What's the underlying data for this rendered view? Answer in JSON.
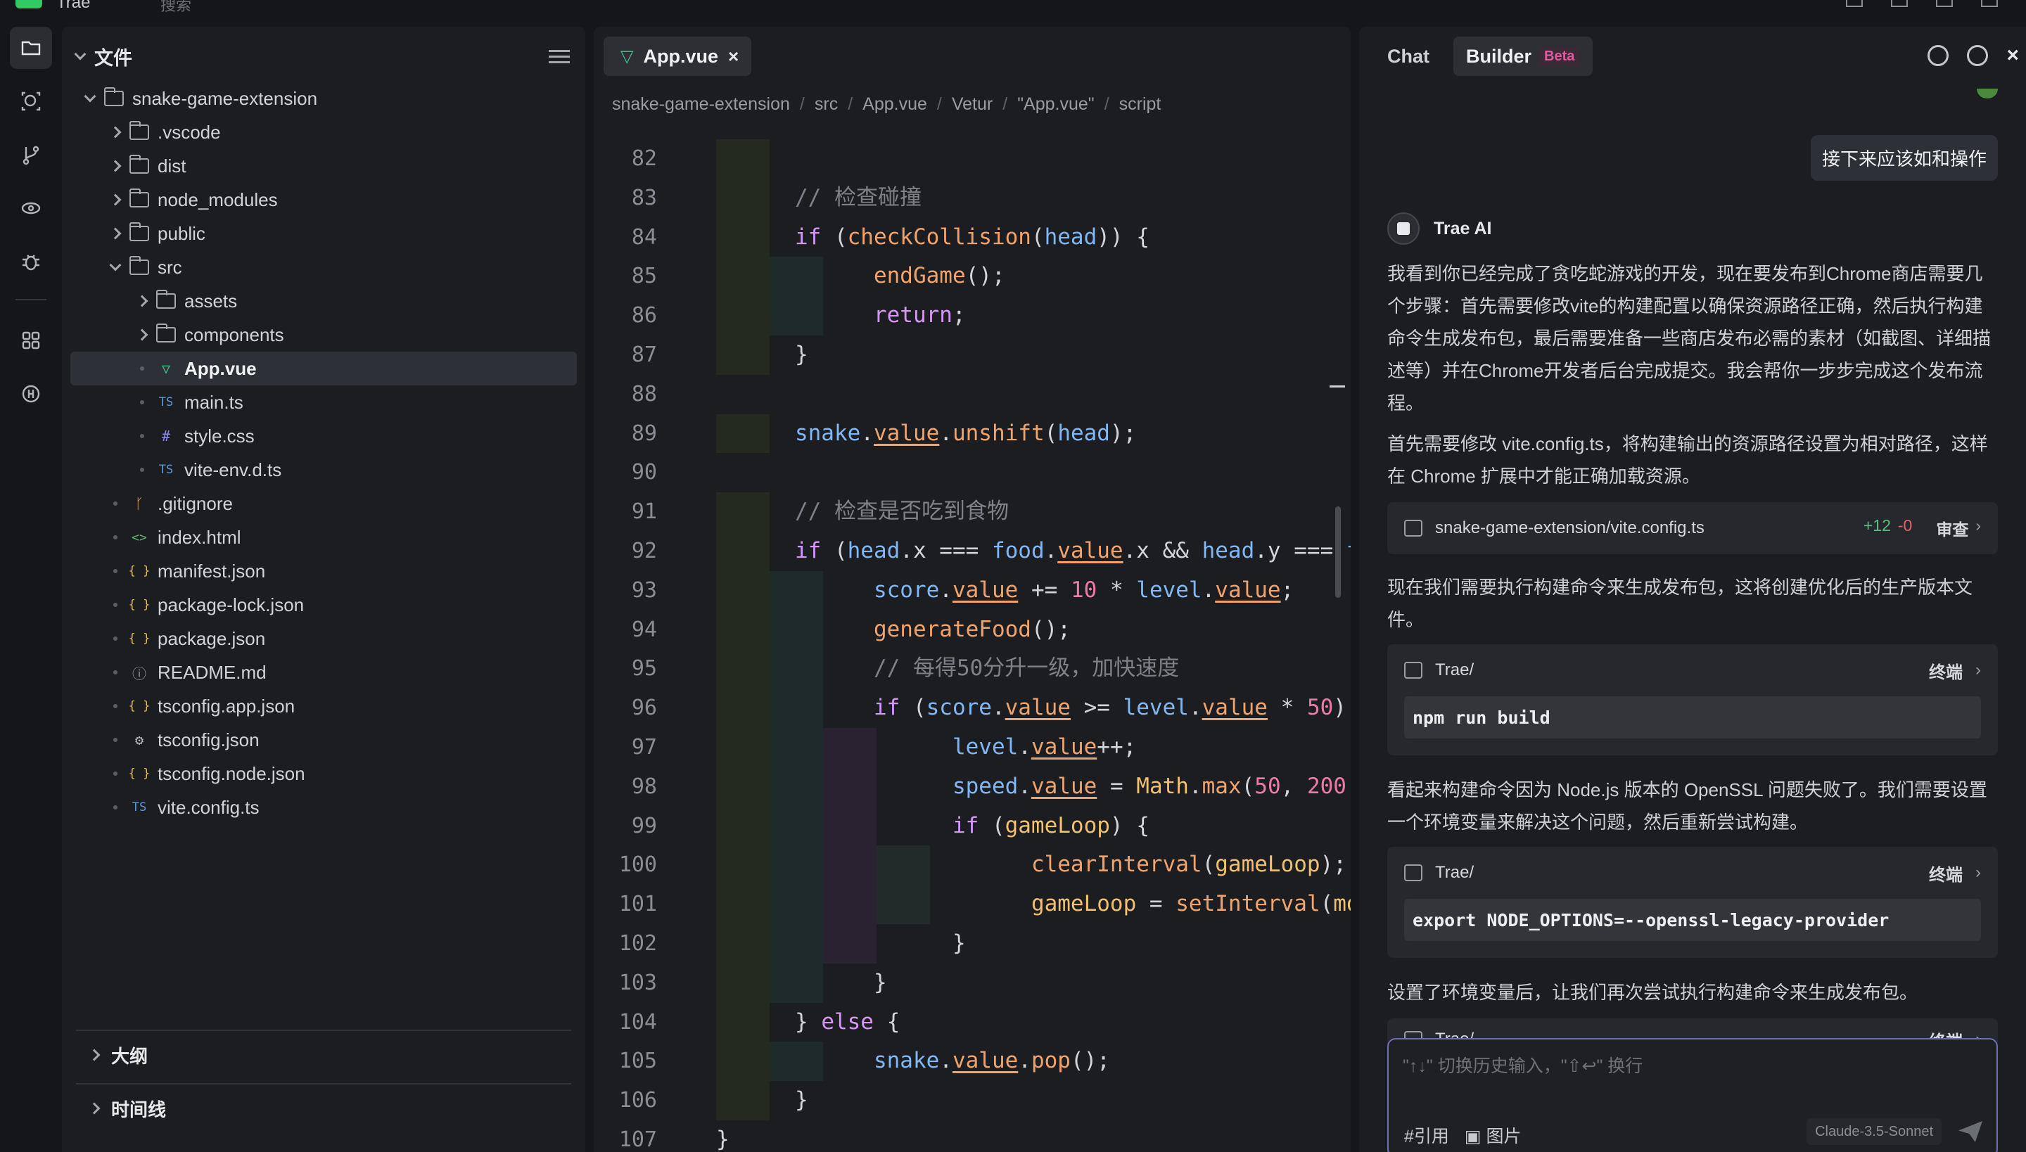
{
  "titlebar": {
    "app_name": "Trae",
    "search_placeholder": "搜索"
  },
  "activity": {
    "items": [
      {
        "icon": "folder-icon",
        "active": true
      },
      {
        "icon": "search-icon"
      },
      {
        "icon": "source-control-icon"
      },
      {
        "icon": "extensions-eye-icon"
      },
      {
        "icon": "debug-icon"
      },
      {
        "icon": "apps-grid-icon"
      },
      {
        "icon": "remote-icon"
      }
    ]
  },
  "explorer": {
    "title": "文件",
    "root": "snake-game-extension",
    "tree": [
      {
        "label": ".vscode",
        "type": "folder",
        "level": 1,
        "expanded": false
      },
      {
        "label": "dist",
        "type": "folder",
        "level": 1,
        "expanded": false
      },
      {
        "label": "node_modules",
        "type": "folder",
        "level": 1,
        "expanded": false
      },
      {
        "label": "public",
        "type": "folder",
        "level": 1,
        "expanded": false
      },
      {
        "label": "src",
        "type": "folder",
        "level": 1,
        "expanded": true
      },
      {
        "label": "assets",
        "type": "folder",
        "level": 2,
        "expanded": false
      },
      {
        "label": "components",
        "type": "folder",
        "level": 2,
        "expanded": false
      },
      {
        "label": "App.vue",
        "type": "vue",
        "level": 2,
        "selected": true
      },
      {
        "label": "main.ts",
        "type": "ts",
        "level": 2
      },
      {
        "label": "style.css",
        "type": "css",
        "level": 2
      },
      {
        "label": "vite-env.d.ts",
        "type": "ts",
        "level": 2
      },
      {
        "label": ".gitignore",
        "type": "git",
        "level": 1
      },
      {
        "label": "index.html",
        "type": "html",
        "level": 1
      },
      {
        "label": "manifest.json",
        "type": "json",
        "level": 1
      },
      {
        "label": "package-lock.json",
        "type": "json",
        "level": 1
      },
      {
        "label": "package.json",
        "type": "json",
        "level": 1
      },
      {
        "label": "README.md",
        "type": "info",
        "level": 1
      },
      {
        "label": "tsconfig.app.json",
        "type": "json",
        "level": 1
      },
      {
        "label": "tsconfig.json",
        "type": "gear",
        "level": 1
      },
      {
        "label": "tsconfig.node.json",
        "type": "json",
        "level": 1
      },
      {
        "label": "vite.config.ts",
        "type": "ts",
        "level": 1
      }
    ],
    "outline_label": "大纲",
    "timeline_label": "时间线"
  },
  "editor": {
    "tab_label": "App.vue",
    "breadcrumb": [
      "snake-game-extension",
      "src",
      "App.vue",
      "Vetur",
      "\"App.vue\"",
      "script"
    ],
    "line_numbers": [
      "82",
      "83",
      "84",
      "85",
      "86",
      "87",
      "88",
      "89",
      "90",
      "91",
      "92",
      "93",
      "94",
      "95",
      "96",
      "97",
      "98",
      "99",
      "100",
      "101",
      "102",
      "103",
      "104",
      "105",
      "106",
      "107"
    ]
  },
  "chat": {
    "tab_chat": "Chat",
    "tab_builder": "Builder",
    "beta_badge": "Beta",
    "user_message": "接下来应该如和操作",
    "ai_name": "Trae AI",
    "msg1": "我看到你已经完成了贪吃蛇游戏的开发，现在要发布到Chrome商店需要几个步骤：首先需要修改vite的构建配置以确保资源路径正确，然后执行构建命令生成发布包，最后需要准备一些商店发布必需的素材（如截图、详细描述等）并在Chrome开发者后台完成提交。我会帮你一步步完成这个发布流程。",
    "msg2": "首先需要修改 vite.config.ts，将构建输出的资源路径设置为相对路径，这样在 Chrome 扩展中才能正确加载资源。",
    "file_card": {
      "path": "snake-game-extension/vite.config.ts",
      "plus": "+12",
      "minus": "-0",
      "action": "审查"
    },
    "msg3": "现在我们需要执行构建命令来生成发布包，这将创建优化后的生产版本文件。",
    "term1": {
      "cwd": "Trae/",
      "label": "终端",
      "cmd": "npm run build"
    },
    "msg4": "看起来构建命令因为 Node.js 版本的 OpenSSL 问题失败了。我们需要设置一个环境变量来解决这个问题，然后重新尝试构建。",
    "term2": {
      "cwd": "Trae/",
      "label": "终端",
      "cmd": "export NODE_OPTIONS=--openssl-legacy-provider"
    },
    "msg5": "设置了环境变量后，让我们再次尝试执行构建命令来生成发布包。",
    "term3": {
      "cwd": "Trae/",
      "label": "终端"
    },
    "input_placeholder": "\"↑↓\" 切换历史输入，\"⇧↩\" 换行",
    "tool_ref": "#引用",
    "tool_image": "图片",
    "model": "Claude-3.5-Sonnet"
  }
}
